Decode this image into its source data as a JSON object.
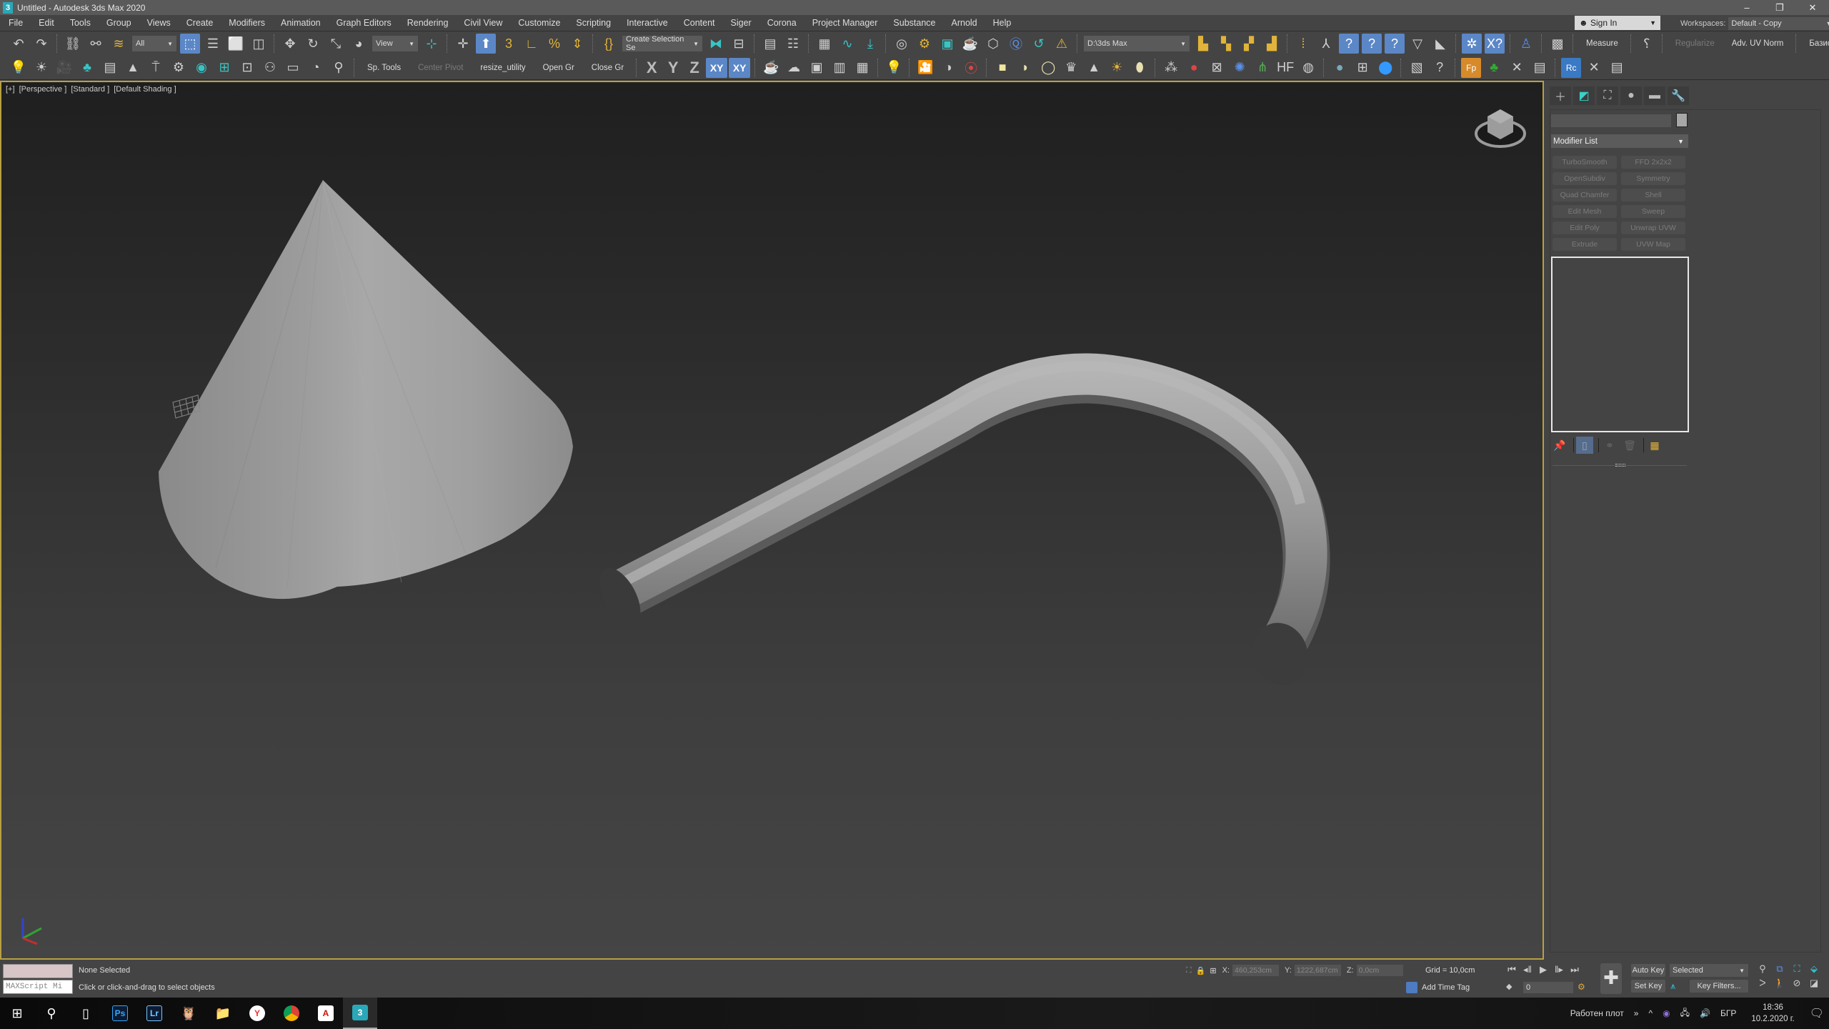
{
  "window": {
    "title": "Untitled - Autodesk 3ds Max 2020",
    "app_icon": "3",
    "controls": [
      "–",
      "❐",
      "✕"
    ]
  },
  "menubar": {
    "items": [
      "File",
      "Edit",
      "Tools",
      "Group",
      "Views",
      "Create",
      "Modifiers",
      "Animation",
      "Graph Editors",
      "Rendering",
      "Civil View",
      "Customize",
      "Scripting",
      "Interactive",
      "Content",
      "Siger",
      "Corona",
      "Project Manager",
      "Substance",
      "Arnold",
      "Help"
    ],
    "sign_in": "Sign In",
    "workspaces_label": "Workspaces:",
    "workspace_value": "Default - Copy"
  },
  "toolbar1": {
    "selection_filter": "All",
    "ref_coord": "View",
    "named_selection": "Create Selection Se",
    "project_path": "D:\\3ds Max",
    "text_buttons": {
      "measure": "Measure",
      "regularize": "Regularize",
      "adv_uv_norm": "Adv. UV Norm",
      "bazis": "Базис"
    }
  },
  "toolbar2": {
    "text_buttons": {
      "sp_tools": "Sp. Tools",
      "center_pivot": "Center Pivot",
      "resize_utility": "resize_utility",
      "open_gr": "Open Gr",
      "close_gr": "Close Gr"
    },
    "axes": {
      "x": "X",
      "y": "Y",
      "z": "Z",
      "xy": "XY",
      "xy_alt": "XY"
    },
    "badges": {
      "fp": "Fp",
      "hf": "HF",
      "rc": "Rc"
    }
  },
  "viewport": {
    "label_parts": [
      "[+]",
      "[Perspective ]",
      "[Standard ]",
      "[Default Shading ]"
    ],
    "objects": [
      "cone",
      "bent-tube",
      "small-grid-gizmo"
    ]
  },
  "command_panel": {
    "tabs": [
      "create",
      "modify",
      "hierarchy",
      "motion",
      "display",
      "utilities"
    ],
    "active_tab": "modify",
    "name_field_value": "",
    "modifier_list_label": "Modifier List",
    "modifier_buttons": [
      [
        "TurboSmooth",
        "FFD 2x2x2"
      ],
      [
        "OpenSubdiv",
        "Symmetry"
      ],
      [
        "Quad Chamfer",
        "Shell"
      ],
      [
        "Edit Mesh",
        "Sweep"
      ],
      [
        "Edit Poly",
        "Unwrap UVW"
      ],
      [
        "Extrude",
        "UVW Map"
      ]
    ]
  },
  "statusbar": {
    "maxscript_listener": "MAXScript Mi",
    "selection_status": "None Selected",
    "prompt": "Click or click-and-drag to select objects",
    "coords": {
      "x_label": "X:",
      "x_value": "460,253cm",
      "y_label": "Y:",
      "y_value": "1222,687cm",
      "z_label": "Z:",
      "z_value": "0,0cm"
    },
    "grid": "Grid = 10,0cm",
    "add_time_tag": "Add Time Tag",
    "current_frame": "0",
    "auto_key": "Auto Key",
    "set_key": "Set Key",
    "key_mode": "Selected",
    "key_filters": "Key Filters..."
  },
  "taskbar": {
    "apps": [
      "start",
      "search",
      "task-view",
      "photoshop",
      "lightroom",
      "app-owl",
      "file-explorer",
      "yandex",
      "chrome",
      "autocad",
      "3ds-max"
    ],
    "badges": {
      "photoshop": "Ps",
      "lightroom": "Lr",
      "yandex": "Y",
      "autocad": "A",
      "max": "3"
    },
    "desktop_label": "Работен плот",
    "chevron": "»",
    "language": "БГР",
    "time": "18:36",
    "date": "10.2.2020 г."
  },
  "colors": {
    "viewport_border": "#b8a044",
    "active_tool": "#5b87c7",
    "panel_bg": "#444444",
    "mesh_gray": "#9a9a9a"
  }
}
